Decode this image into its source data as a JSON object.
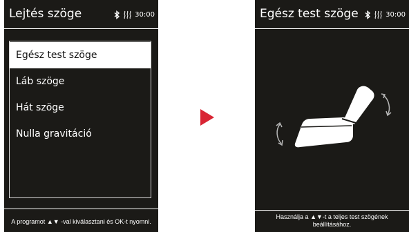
{
  "left_screen": {
    "title": "Lejtés szöge",
    "status": {
      "time": "30:00",
      "icons": [
        "bluetooth-icon",
        "heat-icon"
      ]
    },
    "menu": {
      "items": [
        {
          "label": "Egész test szöge",
          "selected": true
        },
        {
          "label": "Láb szöge",
          "selected": false
        },
        {
          "label": "Hát szöge",
          "selected": false
        },
        {
          "label": "Nulla gravitáció",
          "selected": false
        }
      ]
    },
    "footer": {
      "before": "A programot",
      "up": "▲",
      "down": "▼",
      "after": "-val kiválasztani és OK-t nyomni."
    }
  },
  "transition": {
    "icon": "arrow-right-icon",
    "color": "#d92534"
  },
  "right_screen": {
    "title": "Egész test szöge",
    "status": {
      "time": "30:00",
      "icons": [
        "bluetooth-icon",
        "heat-icon"
      ]
    },
    "graphic": {
      "icons": [
        "massage-chair-icon",
        "rotate-arrow-left-icon",
        "rotate-arrow-right-icon"
      ]
    },
    "footer": {
      "before": "Használja a",
      "up": "▲",
      "down": "▼",
      "after": "-t a teljes test szögének beállításához."
    }
  }
}
